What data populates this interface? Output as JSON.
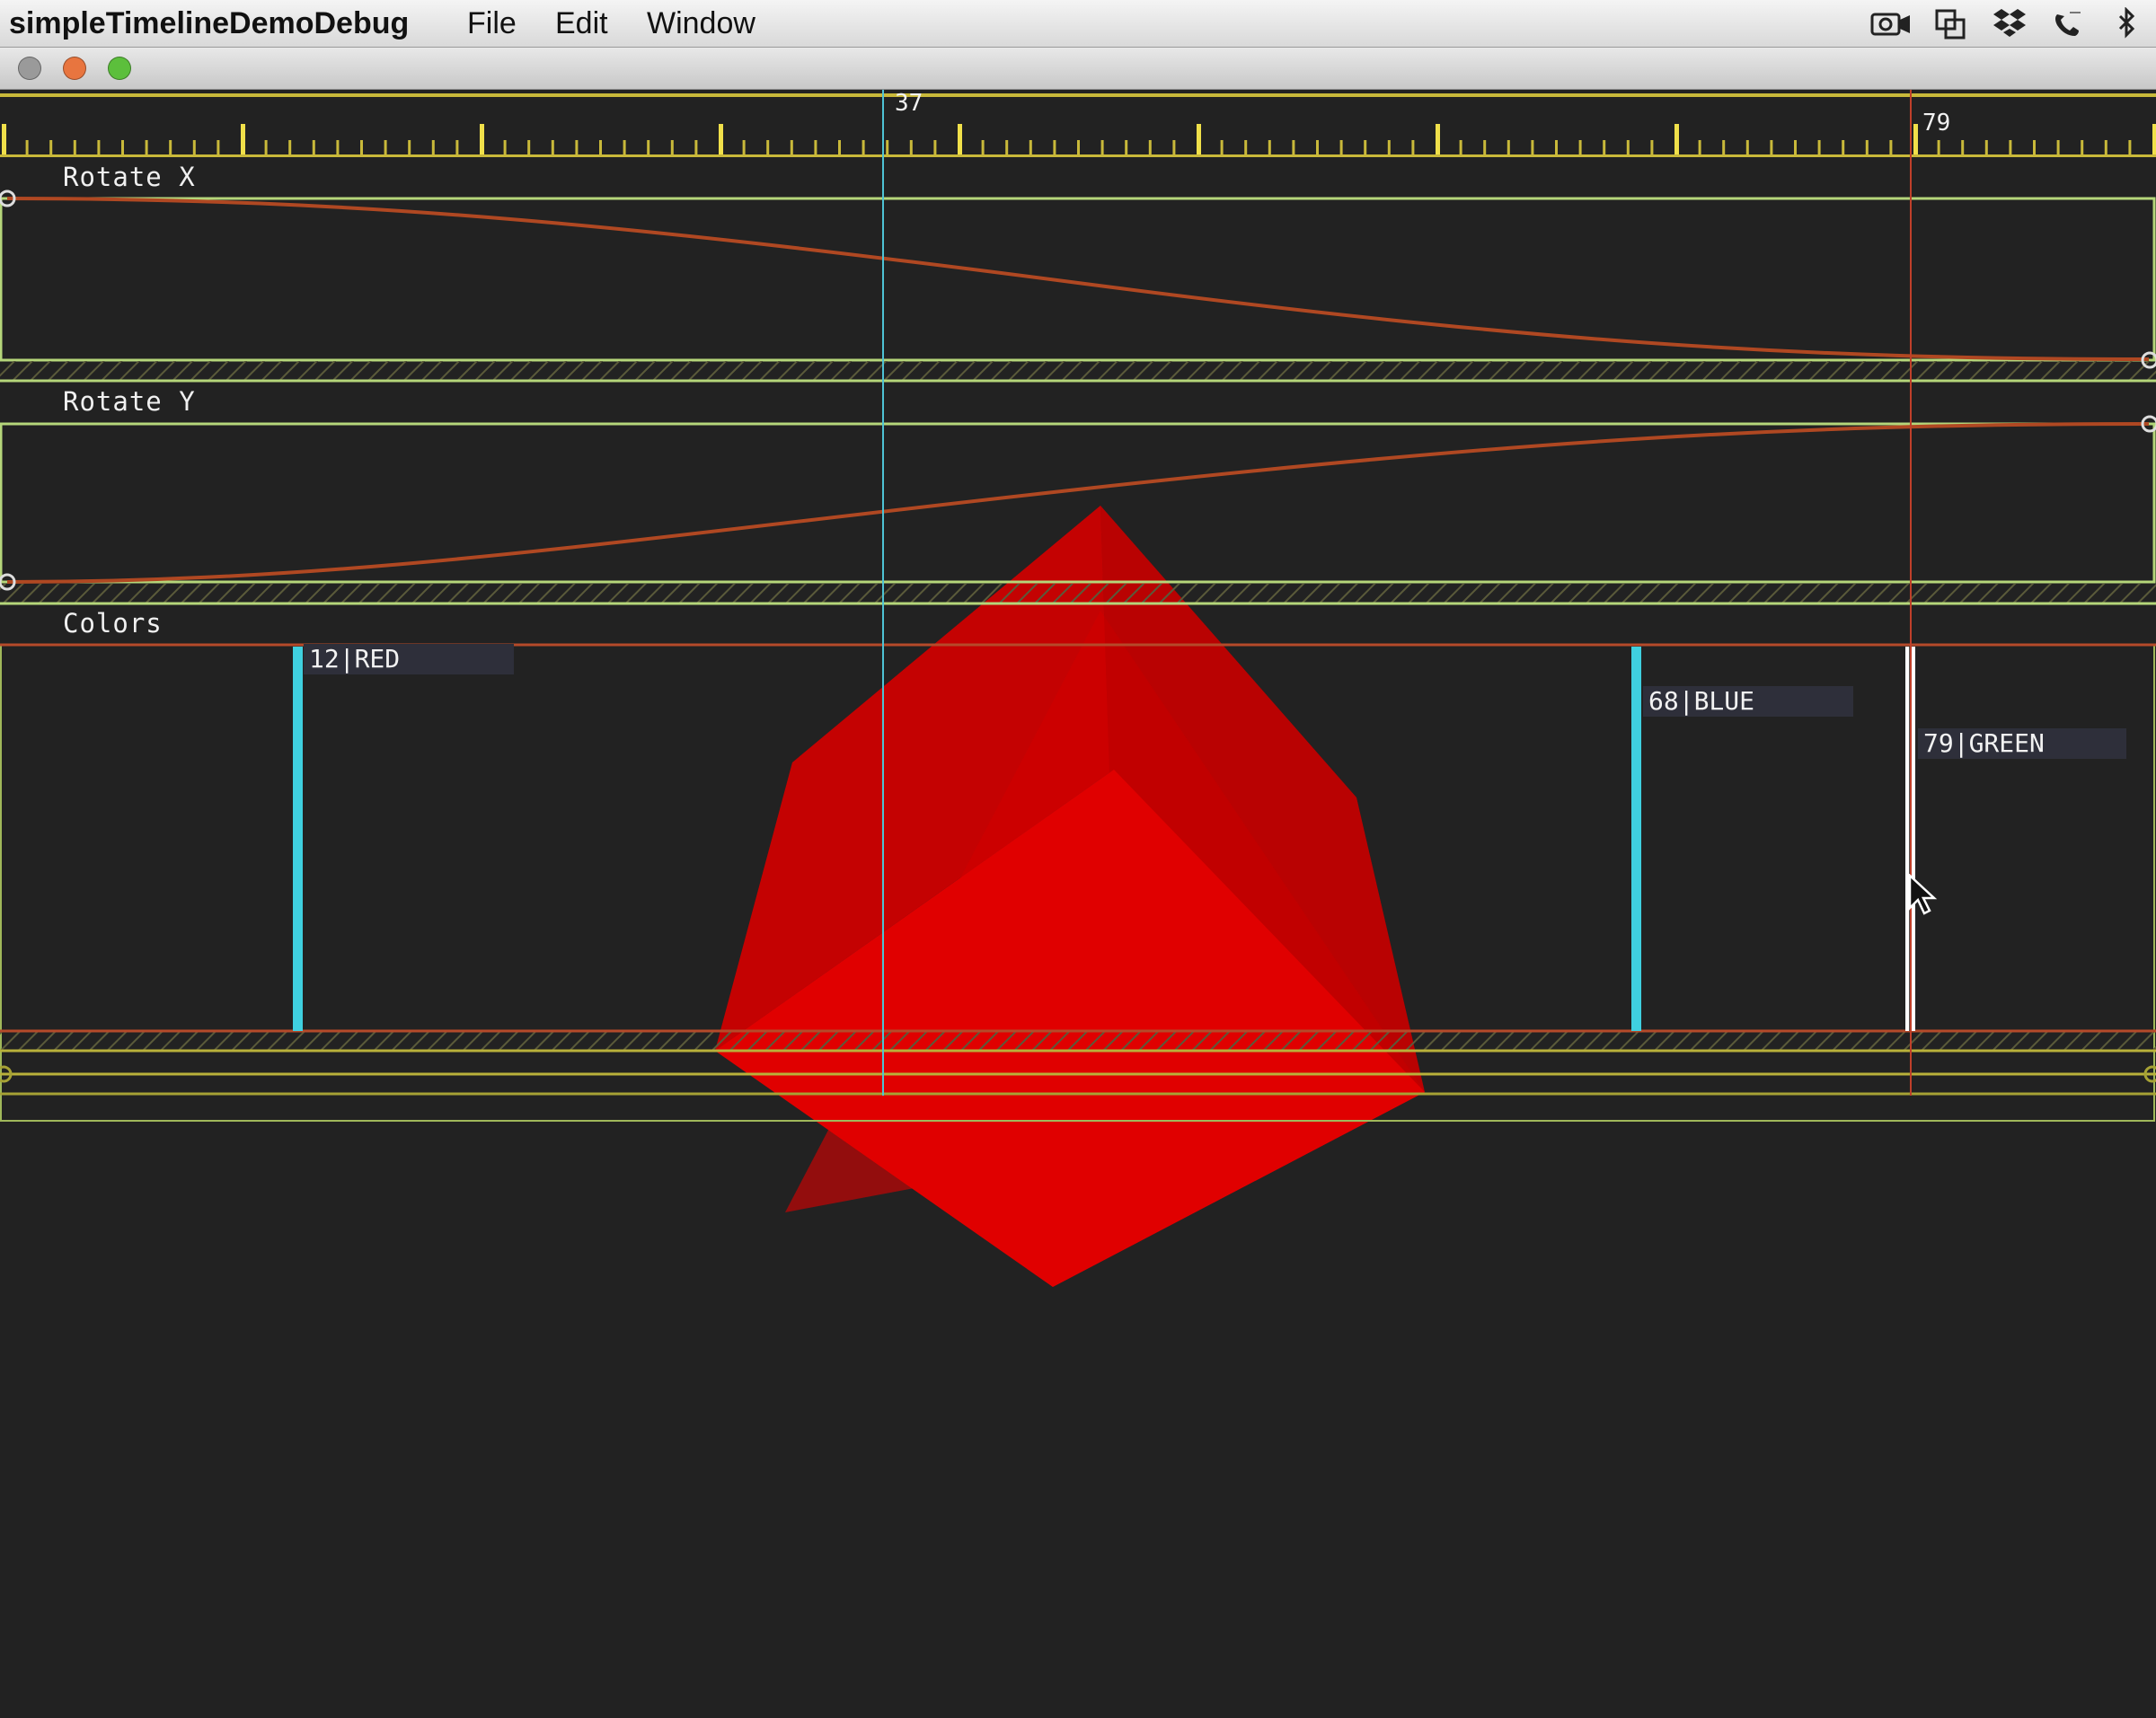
{
  "menubar": {
    "app_title": "simpleTimelineDemoDebug",
    "menus": [
      "File",
      "Edit",
      "Window"
    ],
    "tray_icons": [
      "camera-icon",
      "window-capture-icon",
      "dropbox-icon",
      "phone-icon",
      "bluetooth-icon"
    ]
  },
  "window": {
    "traffic_lights": [
      {
        "name": "close",
        "color": "#9a9a9a"
      },
      {
        "name": "minimize",
        "color": "#e8753f"
      },
      {
        "name": "zoom",
        "color": "#5cbf3c"
      }
    ]
  },
  "timeline": {
    "current_frame": "37",
    "hover_frame": "79",
    "tracks": [
      {
        "label": "Rotate X"
      },
      {
        "label": "Rotate Y"
      },
      {
        "label": "Colors"
      }
    ],
    "color_keyframes": [
      {
        "label": "12|RED",
        "frame": 12
      },
      {
        "label": "68|BLUE",
        "frame": 68
      },
      {
        "label": "79|GREEN",
        "frame": 79
      }
    ]
  },
  "colors": {
    "background": "#222222",
    "ruler_major_tick": "#f0e04a",
    "track_border": "#b5d67a",
    "curve": "#b04822",
    "playhead": "#4ec3d4",
    "hover_line": "#c0402a",
    "keyframe_marker": "#3fd0e0",
    "selected_keyframe": "#ffffff",
    "cube": "#e00000"
  }
}
